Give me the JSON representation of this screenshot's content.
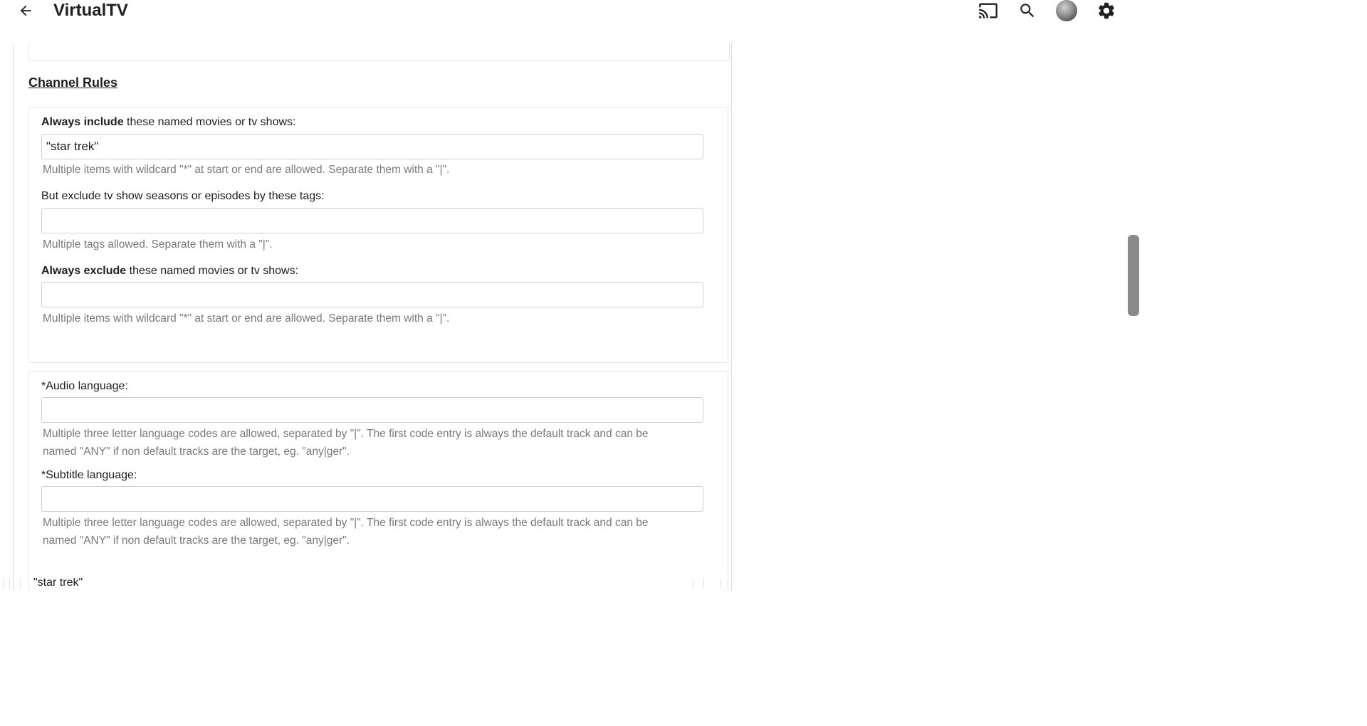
{
  "header": {
    "app_title": "VirtualTV",
    "icons": [
      "arrow-back-icon",
      "cast-icon",
      "search-icon",
      "avatar",
      "gear-icon"
    ]
  },
  "channel_rules": {
    "section_title": "Channel Rules",
    "include": {
      "label_bold": "Always include",
      "label_rest": " these named movies or tv shows:",
      "value": "\"star trek\"",
      "hint": "Multiple items with wildcard \"*\" at start or end are allowed. Separate them with a \"|\"."
    },
    "exclude_tags": {
      "label": "But exclude tv show seasons or episodes by these tags:",
      "value": "",
      "hint": "Multiple tags allowed. Separate them with a \"|\"."
    },
    "exclude": {
      "label_bold": "Always exclude",
      "label_rest": " these named movies or tv shows:",
      "value": "",
      "hint": "Multiple items with wildcard \"*\" at start or end are allowed. Separate them with a \"|\"."
    }
  },
  "languages": {
    "audio": {
      "label": "*Audio language:",
      "value": "",
      "hint_line1": "Multiple three letter language codes are allowed, separated by \"|\". The first code entry is always the default track and can be",
      "hint_line2": "named \"ANY\" if non default tracks are the target, eg. \"any|ger\"."
    },
    "subtitle": {
      "label": "*Subtitle language:",
      "value": "",
      "hint_line1": "Multiple three letter language codes are allowed, separated by \"|\". The first code entry is always the default track and can be",
      "hint_line2": "named \"ANY\" if non default tracks are the target, eg. \"any|ger\"."
    }
  },
  "overflow_text": "\"star trek\"",
  "colors": {
    "border": "#e6e6e6",
    "field_border": "#d0d0d0",
    "hint_text": "#7a7a7a",
    "scrollbar": "#8a8a8a"
  }
}
